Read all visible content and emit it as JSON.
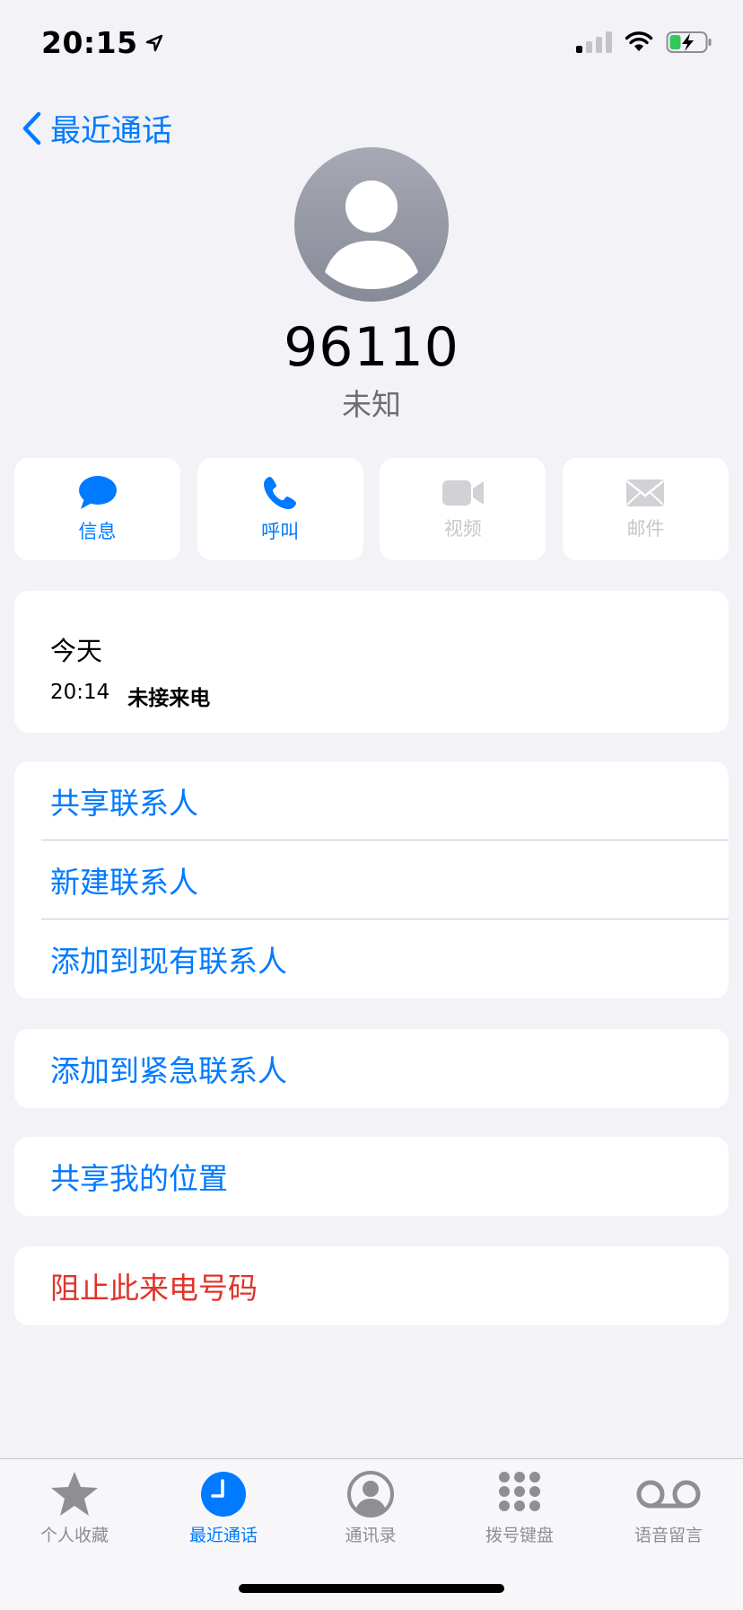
{
  "status_bar": {
    "time": "20:15"
  },
  "nav": {
    "back_label": "最近通话"
  },
  "contact": {
    "number": "96110",
    "subtitle": "未知"
  },
  "actions": [
    {
      "label": "信息",
      "icon": "message-icon",
      "enabled": true
    },
    {
      "label": "呼叫",
      "icon": "phone-icon",
      "enabled": true
    },
    {
      "label": "视频",
      "icon": "video-icon",
      "enabled": false
    },
    {
      "label": "邮件",
      "icon": "mail-icon",
      "enabled": false
    }
  ],
  "recents": {
    "day": "今天",
    "entries": [
      {
        "time": "20:14",
        "status": "未接来电"
      }
    ]
  },
  "menu": {
    "share_contact": "共享联系人",
    "new_contact": "新建联系人",
    "add_existing": "添加到现有联系人",
    "add_emergency": "添加到紧急联系人",
    "share_location": "共享我的位置",
    "block_caller": "阻止此来电号码"
  },
  "tabs": [
    {
      "label": "个人收藏",
      "icon": "star-icon",
      "active": false
    },
    {
      "label": "最近通话",
      "icon": "clock-icon",
      "active": true
    },
    {
      "label": "通讯录",
      "icon": "person-circle-icon",
      "active": false
    },
    {
      "label": "拨号键盘",
      "icon": "keypad-icon",
      "active": false
    },
    {
      "label": "语音留言",
      "icon": "voicemail-icon",
      "active": false
    }
  ],
  "colors": {
    "accent": "#007aff",
    "destructive": "#e0342b",
    "background": "#f2f2f7",
    "disabled": "#c7c7cc"
  }
}
